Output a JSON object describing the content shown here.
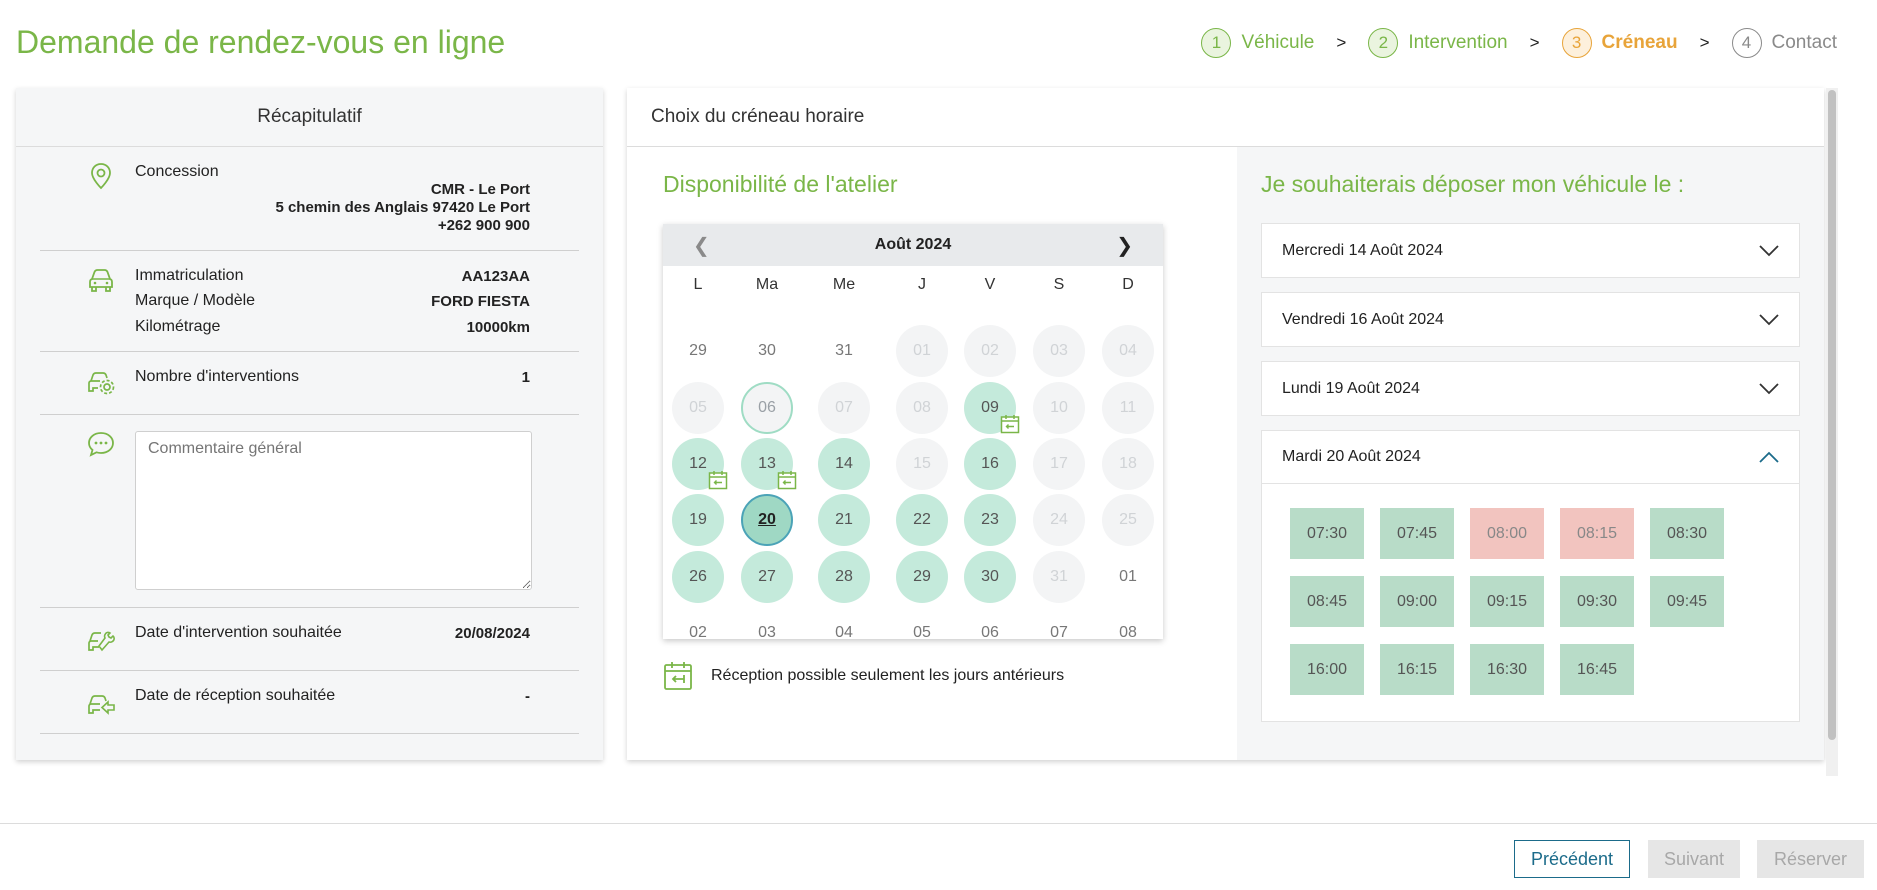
{
  "page": {
    "title": "Demande de rendez-vous en ligne"
  },
  "steps": [
    {
      "num": "1",
      "label": "Véhicule",
      "state": "done"
    },
    {
      "num": "2",
      "label": "Intervention",
      "state": "done"
    },
    {
      "num": "3",
      "label": "Créneau",
      "state": "active"
    },
    {
      "num": "4",
      "label": "Contact",
      "state": "pending"
    }
  ],
  "step_separator": ">",
  "summary": {
    "title": "Récapitulatif",
    "concession_label": "Concession",
    "concession_name": "CMR - Le Port",
    "concession_address": "5 chemin des Anglais 97420 Le Port",
    "concession_phone": "+262 900 900",
    "plate_label": "Immatriculation",
    "plate_value": "AA123AA",
    "model_label": "Marque / Modèle",
    "model_value": "FORD FIESTA",
    "mileage_label": "Kilométrage",
    "mileage_value": "10000km",
    "interventions_label": "Nombre d'interventions",
    "interventions_value": "1",
    "comment_placeholder": "Commentaire général",
    "comment_value": "",
    "intervention_date_label": "Date d'intervention souhaitée",
    "intervention_date_value": "20/08/2024",
    "reception_date_label": "Date de réception souhaitée",
    "reception_date_value": "-"
  },
  "slot_panel": {
    "title": "Choix du créneau horaire",
    "availability_heading": "Disponibilité de l'atelier",
    "deposit_heading": "Je souhaiterais déposer mon véhicule le :",
    "legend": "Réception possible seulement les jours antérieurs"
  },
  "calendar": {
    "month": "Août 2024",
    "prev": "❮",
    "next": "❯",
    "weekdays": [
      "L",
      "Ma",
      "Me",
      "J",
      "V",
      "S",
      "D"
    ],
    "weeks": [
      [
        {
          "d": "29",
          "s": "other"
        },
        {
          "d": "30",
          "s": "other"
        },
        {
          "d": "31",
          "s": "other"
        },
        {
          "d": "01",
          "s": "disabled"
        },
        {
          "d": "02",
          "s": "disabled"
        },
        {
          "d": "03",
          "s": "disabled"
        },
        {
          "d": "04",
          "s": "disabled"
        }
      ],
      [
        {
          "d": "05",
          "s": "disabled"
        },
        {
          "d": "06",
          "s": "today"
        },
        {
          "d": "07",
          "s": "disabled"
        },
        {
          "d": "08",
          "s": "disabled"
        },
        {
          "d": "09",
          "s": "avail",
          "badge": true
        },
        {
          "d": "10",
          "s": "disabled"
        },
        {
          "d": "11",
          "s": "disabled"
        }
      ],
      [
        {
          "d": "12",
          "s": "avail",
          "badge": true
        },
        {
          "d": "13",
          "s": "avail",
          "badge": true
        },
        {
          "d": "14",
          "s": "avail"
        },
        {
          "d": "15",
          "s": "disabled"
        },
        {
          "d": "16",
          "s": "avail"
        },
        {
          "d": "17",
          "s": "disabled"
        },
        {
          "d": "18",
          "s": "disabled"
        }
      ],
      [
        {
          "d": "19",
          "s": "avail"
        },
        {
          "d": "20",
          "s": "selected"
        },
        {
          "d": "21",
          "s": "avail"
        },
        {
          "d": "22",
          "s": "avail"
        },
        {
          "d": "23",
          "s": "avail"
        },
        {
          "d": "24",
          "s": "disabled"
        },
        {
          "d": "25",
          "s": "disabled"
        }
      ],
      [
        {
          "d": "26",
          "s": "avail"
        },
        {
          "d": "27",
          "s": "avail"
        },
        {
          "d": "28",
          "s": "avail"
        },
        {
          "d": "29",
          "s": "avail"
        },
        {
          "d": "30",
          "s": "avail"
        },
        {
          "d": "31",
          "s": "disabled"
        },
        {
          "d": "01",
          "s": "other"
        }
      ],
      [
        {
          "d": "02",
          "s": "other"
        },
        {
          "d": "03",
          "s": "other"
        },
        {
          "d": "04",
          "s": "other"
        },
        {
          "d": "05",
          "s": "other"
        },
        {
          "d": "06",
          "s": "other"
        },
        {
          "d": "07",
          "s": "other"
        },
        {
          "d": "08",
          "s": "other"
        }
      ]
    ]
  },
  "dates": [
    {
      "label": "Mercredi 14 Août 2024",
      "open": false
    },
    {
      "label": "Vendredi 16 Août 2024",
      "open": false
    },
    {
      "label": "Lundi 19 Août 2024",
      "open": false
    },
    {
      "label": "Mardi 20 Août 2024",
      "open": true
    }
  ],
  "time_slots": [
    {
      "time": "07:30",
      "status": "available"
    },
    {
      "time": "07:45",
      "status": "available"
    },
    {
      "time": "08:00",
      "status": "full"
    },
    {
      "time": "08:15",
      "status": "full"
    },
    {
      "time": "08:30",
      "status": "available"
    },
    {
      "time": "08:45",
      "status": "available"
    },
    {
      "time": "09:00",
      "status": "available"
    },
    {
      "time": "09:15",
      "status": "available"
    },
    {
      "time": "09:30",
      "status": "available"
    },
    {
      "time": "09:45",
      "status": "available"
    },
    {
      "time": "16:00",
      "status": "available"
    },
    {
      "time": "16:15",
      "status": "available"
    },
    {
      "time": "16:30",
      "status": "available"
    },
    {
      "time": "16:45",
      "status": "available"
    }
  ],
  "buttons": {
    "previous": "Précédent",
    "next": "Suivant",
    "book": "Réserver"
  },
  "colors": {
    "brand_green": "#7ab648",
    "active_orange": "#e8a43a",
    "available_slot": "#b8dcc8",
    "full_slot": "#f2c4bf",
    "primary_blue": "#1b6b8a"
  }
}
